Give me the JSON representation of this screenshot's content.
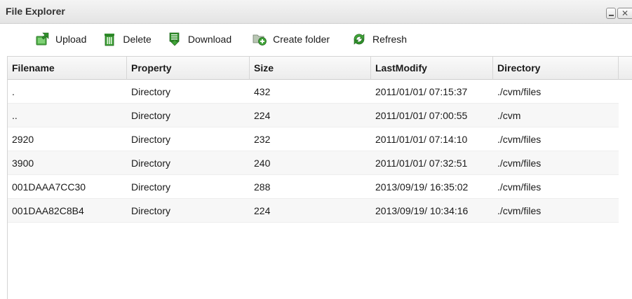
{
  "window": {
    "title": "File Explorer"
  },
  "toolbar": {
    "upload_label": "Upload",
    "delete_label": "Delete",
    "download_label": "Download",
    "create_folder_label": "Create folder",
    "refresh_label": "Refresh"
  },
  "table": {
    "columns": [
      "Filename",
      "Property",
      "Size",
      "LastModify",
      "Directory"
    ],
    "rows": [
      {
        "filename": ".",
        "property": "Directory",
        "size": "432",
        "last_modify": "2011/01/01/ 07:15:37",
        "directory": "./cvm/files"
      },
      {
        "filename": "..",
        "property": "Directory",
        "size": "224",
        "last_modify": "2011/01/01/ 07:00:55",
        "directory": "./cvm"
      },
      {
        "filename": "2920",
        "property": "Directory",
        "size": "232",
        "last_modify": "2011/01/01/ 07:14:10",
        "directory": "./cvm/files"
      },
      {
        "filename": "3900",
        "property": "Directory",
        "size": "240",
        "last_modify": "2011/01/01/ 07:32:51",
        "directory": "./cvm/files"
      },
      {
        "filename": "001DAAA7CC30",
        "property": "Directory",
        "size": "288",
        "last_modify": "2013/09/19/ 16:35:02",
        "directory": "./cvm/files"
      },
      {
        "filename": "001DAA82C8B4",
        "property": "Directory",
        "size": "224",
        "last_modify": "2013/09/19/ 10:34:16",
        "directory": "./cvm/files"
      }
    ]
  },
  "icons": {
    "upload": "upload-icon",
    "delete": "trash-icon",
    "download": "download-icon",
    "create_folder": "add-folder-icon",
    "refresh": "refresh-icon",
    "minimize": "minimize-icon",
    "close": "close-icon"
  },
  "colors": {
    "icon_green": "#3a9a3a",
    "header_bg": "#ececec",
    "alt_row": "#f7f7f7"
  }
}
